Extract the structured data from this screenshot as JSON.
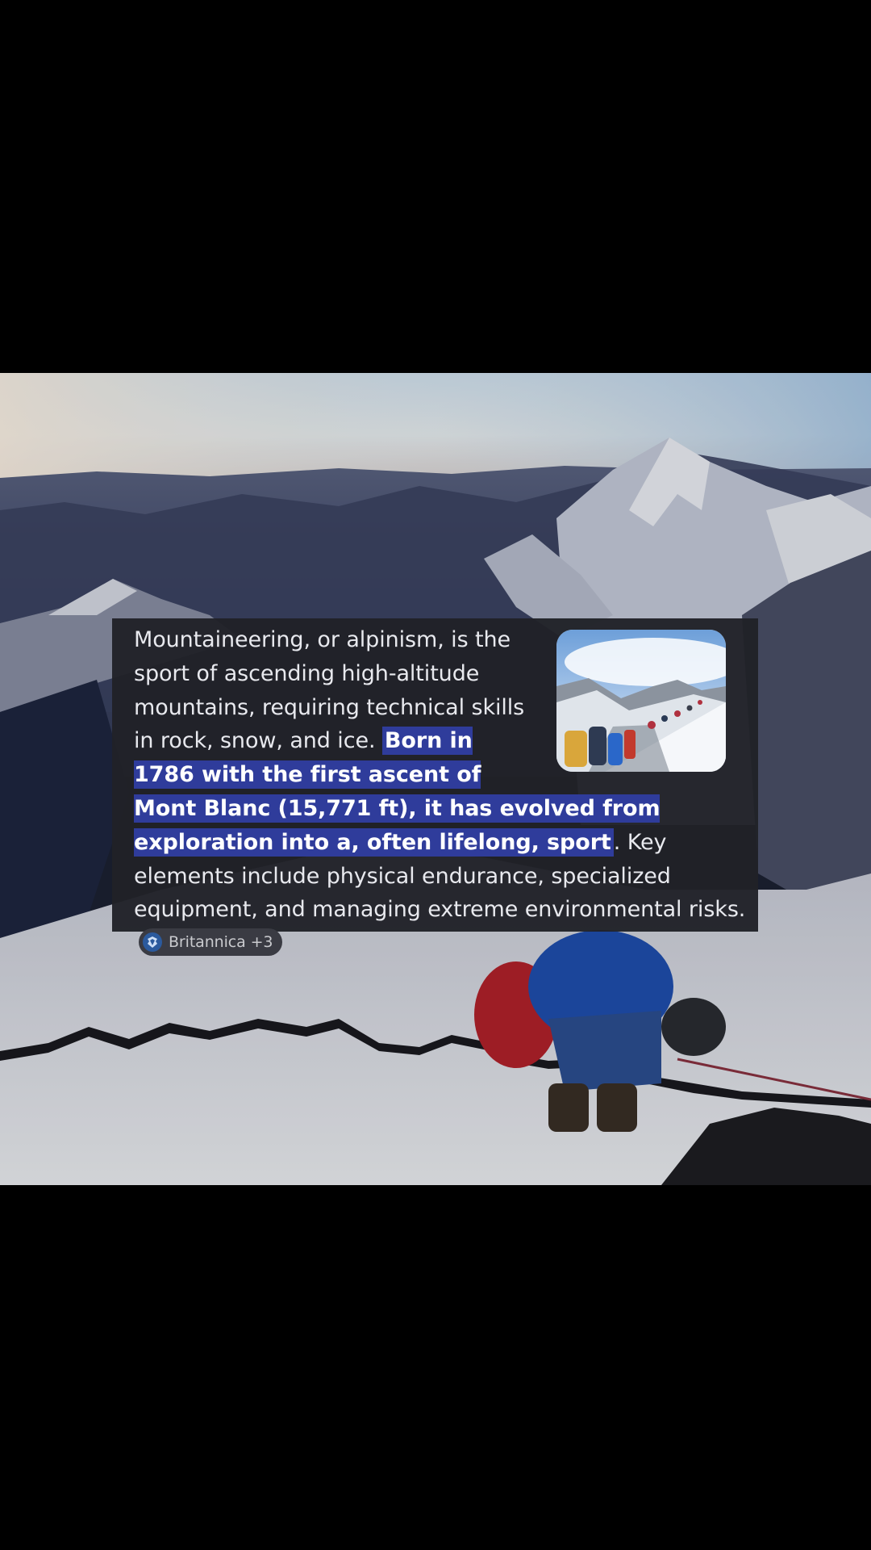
{
  "overview": {
    "intro_text": "Mountaineering, or alpinism, is the sport of ascending high-altitude mountains, requiring technical skills in rock, snow, and ice.",
    "highlight_text": "Born in 1786 with the first ascent of Mont Blanc (15,771 ft), it has evolved from exploration into a, often lifelong, sport",
    "tail_text": ". Key elements include physical endurance, specialized equipment, and managing extreme environmental risks.",
    "highlight_color": "#2f3c9b",
    "card_background": "#202128",
    "text_color": "#e8e9ee"
  },
  "source_chip": {
    "label": "Britannica +3",
    "icon": "britannica-logo-icon"
  },
  "thumbnail": {
    "subject": "climbers-on-snow-ridge"
  },
  "background": {
    "subject": "climbers-on-snowy-summit"
  }
}
